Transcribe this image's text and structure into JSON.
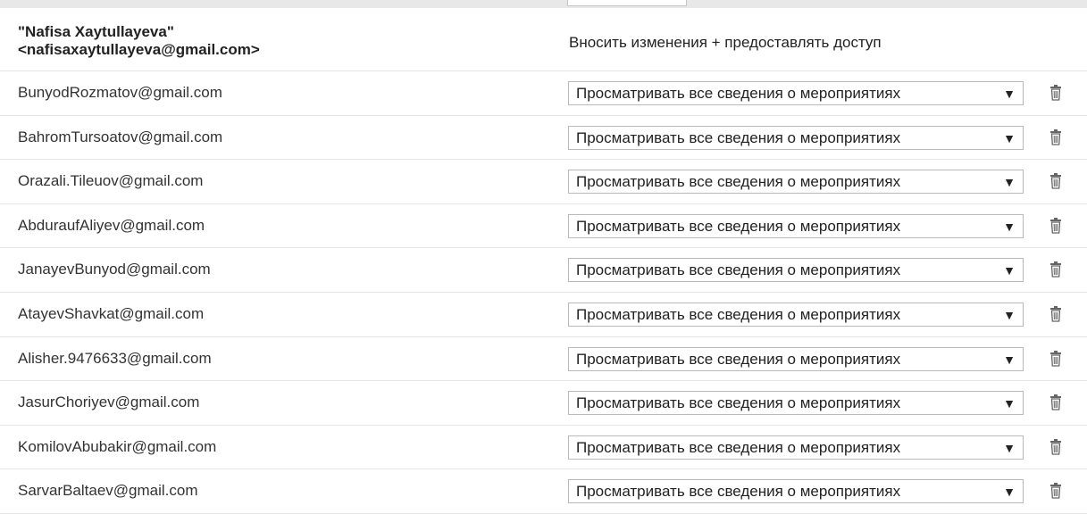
{
  "owner": {
    "name_line1": "\"Nafisa Xaytullayeva\"",
    "name_line2": "<nafisaxaytullayeva@gmail.com>",
    "permission": "Вносить изменения + предоставлять доступ"
  },
  "icons": {
    "dropdown": "chevron-down-icon",
    "delete": "trash-icon"
  },
  "rows": [
    {
      "email": "BunyodRozmatov@gmail.com",
      "permission": "Просматривать все сведения о мероприятиях"
    },
    {
      "email": "BahromTursoatov@gmail.com",
      "permission": "Просматривать все сведения о мероприятиях"
    },
    {
      "email": "Orazali.Tileuov@gmail.com",
      "permission": "Просматривать все сведения о мероприятиях"
    },
    {
      "email": "AbduraufAliyev@gmail.com",
      "permission": "Просматривать все сведения о мероприятиях"
    },
    {
      "email": "JanayevBunyod@gmail.com",
      "permission": "Просматривать все сведения о мероприятиях"
    },
    {
      "email": "AtayevShavkat@gmail.com",
      "permission": "Просматривать все сведения о мероприятиях"
    },
    {
      "email": "Alisher.9476633@gmail.com",
      "permission": "Просматривать все сведения о мероприятиях"
    },
    {
      "email": "JasurChoriyev@gmail.com",
      "permission": "Просматривать все сведения о мероприятиях"
    },
    {
      "email": "KomilovAbubakir@gmail.com",
      "permission": "Просматривать все сведения о мероприятиях"
    },
    {
      "email": "SarvarBaltaev@gmail.com",
      "permission": "Просматривать все сведения о мероприятиях"
    }
  ]
}
